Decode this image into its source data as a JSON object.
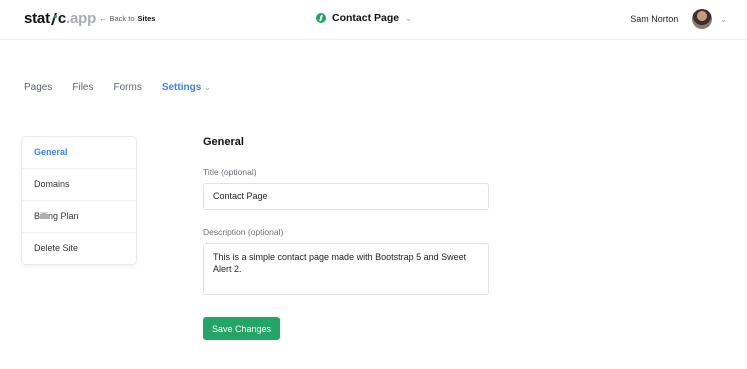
{
  "header": {
    "logo": {
      "part1": "stat",
      "part2": "c",
      "suffix": ".app"
    },
    "back_arrow": "←",
    "back_prefix": "Back to",
    "back_target": "Sites",
    "project_name": "Contact Page",
    "project_chevron": "⌄",
    "user_name": "Sam Norton",
    "user_chevron": "⌄"
  },
  "tabs": [
    {
      "label": "Pages"
    },
    {
      "label": "Files"
    },
    {
      "label": "Forms"
    },
    {
      "label": "Settings",
      "active": true
    }
  ],
  "settings_chevron": "⌄",
  "sidebar": {
    "items": [
      {
        "label": "General",
        "active": true
      },
      {
        "label": "Domains"
      },
      {
        "label": "Billing Plan"
      },
      {
        "label": "Delete Site"
      }
    ]
  },
  "form": {
    "heading": "General",
    "title_label": "Title (optional)",
    "title_value": "Contact Page",
    "description_label": "Description (optional)",
    "description_value": "This is a simple contact page made with Bootstrap 5 and Sweet Alert 2.",
    "save_label": "Save Changes"
  },
  "colors": {
    "accent": "#3b82f6",
    "success": "#22a565"
  }
}
